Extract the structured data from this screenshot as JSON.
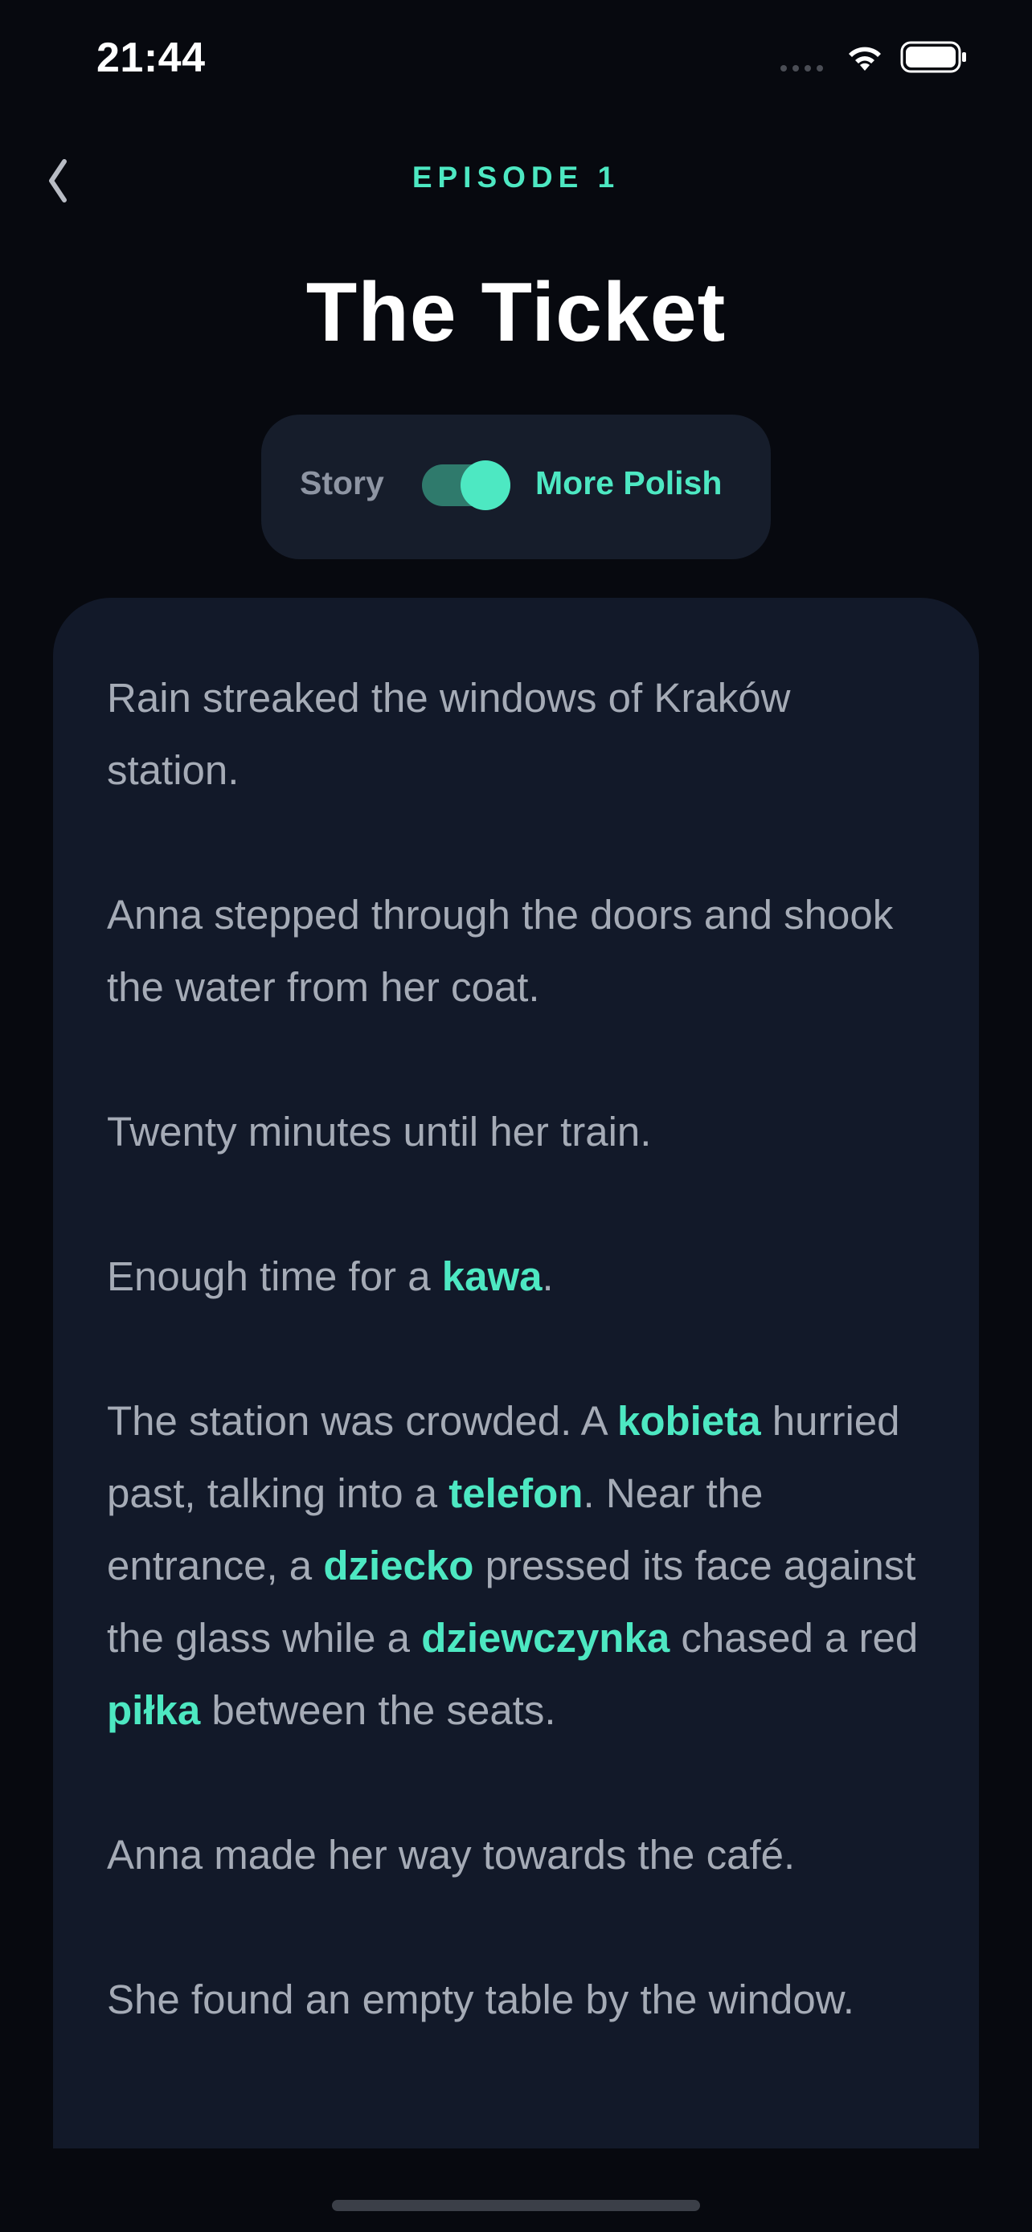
{
  "status_bar": {
    "time": "21:44"
  },
  "header": {
    "episode_label": "EPISODE 1",
    "title": "The Ticket",
    "back_icon": "chevron-left-icon"
  },
  "mode_toggle": {
    "left_label": "Story",
    "right_label": "More Polish",
    "enabled": true
  },
  "story": {
    "paragraphs": [
      [
        {
          "text": "Rain streaked the windows of Kraków station."
        }
      ],
      [
        {
          "text": "Anna stepped through the doors and shook the water from her coat."
        }
      ],
      [
        {
          "text": "Twenty minutes until her train."
        }
      ],
      [
        {
          "text": "Enough time for a "
        },
        {
          "text": "kawa",
          "vocab": true
        },
        {
          "text": "."
        }
      ],
      [
        {
          "text": "The station was crowded. A "
        },
        {
          "text": "kobieta",
          "vocab": true
        },
        {
          "text": " hurried past, talking into a "
        },
        {
          "text": "telefon",
          "vocab": true
        },
        {
          "text": ". Near the entrance, a "
        },
        {
          "text": "dziecko",
          "vocab": true
        },
        {
          "text": " pressed its face against the glass while a "
        },
        {
          "text": "dziewczynka",
          "vocab": true
        },
        {
          "text": " chased a red "
        },
        {
          "text": "piłka",
          "vocab": true
        },
        {
          "text": " between the seats."
        }
      ],
      [
        {
          "text": "Anna made her way towards the café."
        }
      ],
      [
        {
          "text": "She found an empty table by the window."
        }
      ]
    ]
  },
  "colors": {
    "background": "#07090f",
    "card": "#121929",
    "accent": "#4de8c2",
    "body_text": "#a5abb6"
  }
}
